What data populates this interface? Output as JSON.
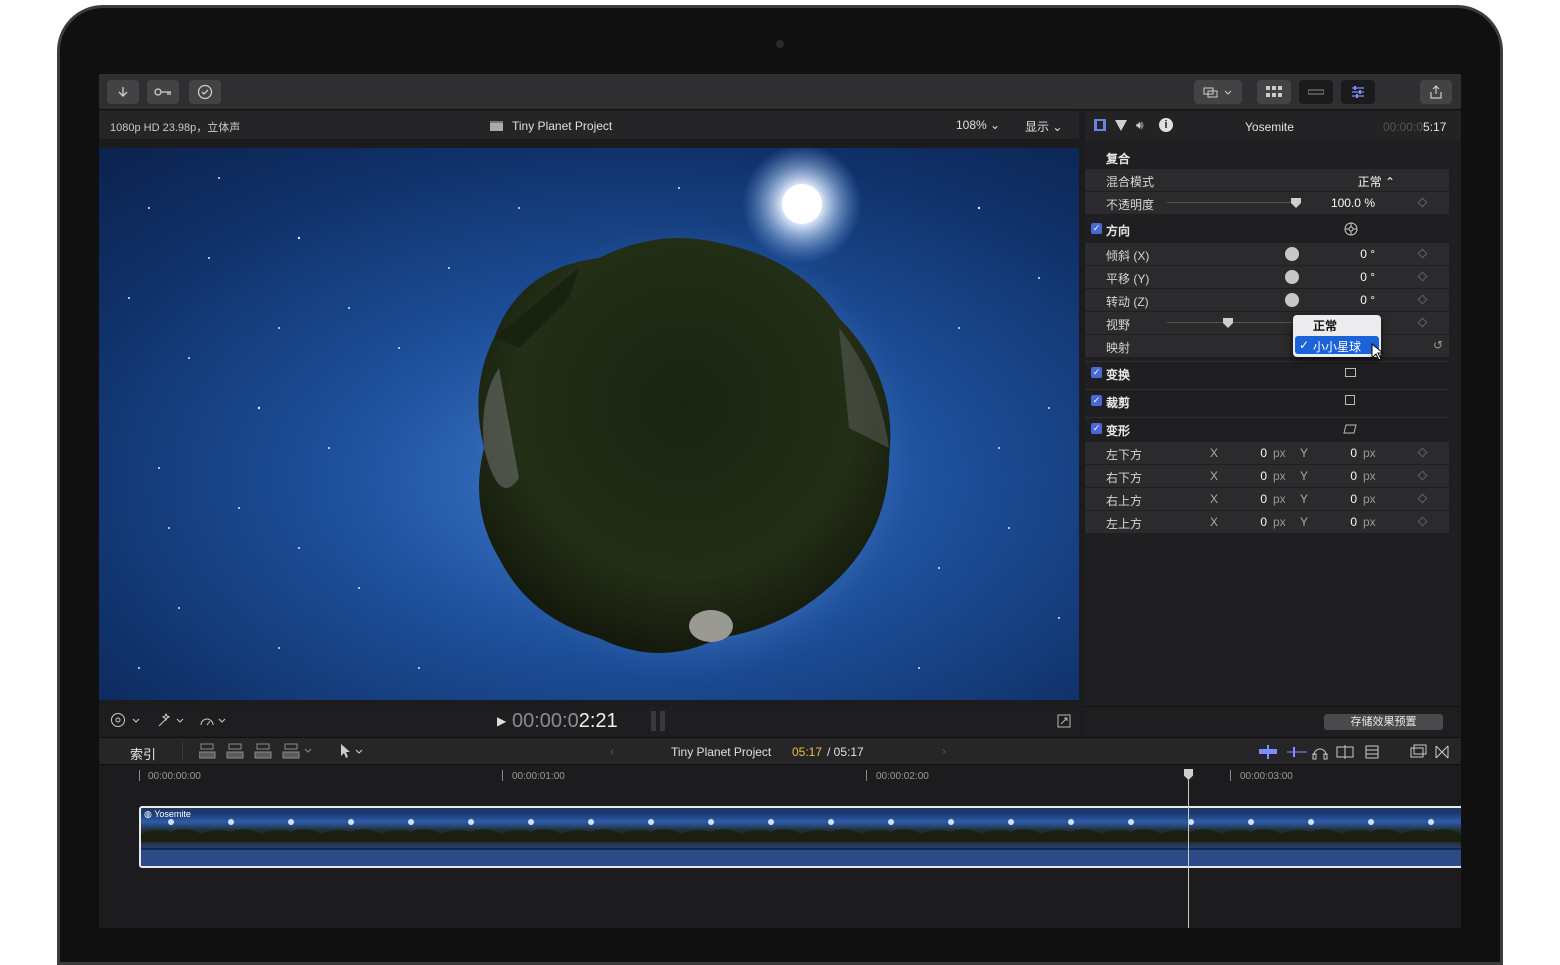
{
  "toolbar": {
    "buttons": [
      "import",
      "keywords",
      "background-tasks",
      "window-layout",
      "browser",
      "timeline-index",
      "inspector",
      "share"
    ]
  },
  "viewer": {
    "format": "1080p HD 23.98p，立体声",
    "project": "Tiny Planet Project",
    "zoom": "108%",
    "display": "显示",
    "timecode_dim": "00:00:0",
    "timecode_bright": "2:21"
  },
  "inspector": {
    "clip_name": "Yosemite",
    "duration_dim": "00:00:0",
    "duration_bright": "5:17",
    "composite": {
      "title": "复合",
      "blend_label": "混合模式",
      "blend_value": "正常 ⌃",
      "opacity_label": "不透明度",
      "opacity_value": "100.0 %",
      "opacity_fraction": 1.0
    },
    "orientation": {
      "title": "方向",
      "tilt_label": "倾斜 (X)",
      "tilt_value": "0 °",
      "pan_label": "平移 (Y)",
      "pan_value": "0 °",
      "roll_label": "转动 (Z)",
      "roll_value": "0 °",
      "fov_label": "视野",
      "mapping_label": "映射"
    },
    "mapping_menu": {
      "options": [
        "正常",
        "小小星球"
      ],
      "selected": "小小星球"
    },
    "sections": [
      "变换",
      "裁剪",
      "变形"
    ],
    "distort": [
      {
        "label": "左下方",
        "x": "0",
        "y": "0"
      },
      {
        "label": "右下方",
        "x": "0",
        "y": "0"
      },
      {
        "label": "右上方",
        "x": "0",
        "y": "0"
      },
      {
        "label": "左上方",
        "x": "0",
        "y": "0"
      }
    ],
    "axis_x": "X",
    "axis_y": "Y",
    "unit": "px",
    "save_preset": "存储效果预置"
  },
  "timeline": {
    "index_label": "索引",
    "project": "Tiny Planet Project",
    "position": "05:17",
    "duration": "/ 05:17",
    "ruler": [
      "00:00:00:00",
      "00:00:01:00",
      "00:00:02:00",
      "00:00:03:00"
    ],
    "clip_name": "Yosemite"
  },
  "colors": {
    "accent": "#4a68d6",
    "position_yellow": "#e8c13a",
    "menu_highlight": "#1a63d9"
  }
}
